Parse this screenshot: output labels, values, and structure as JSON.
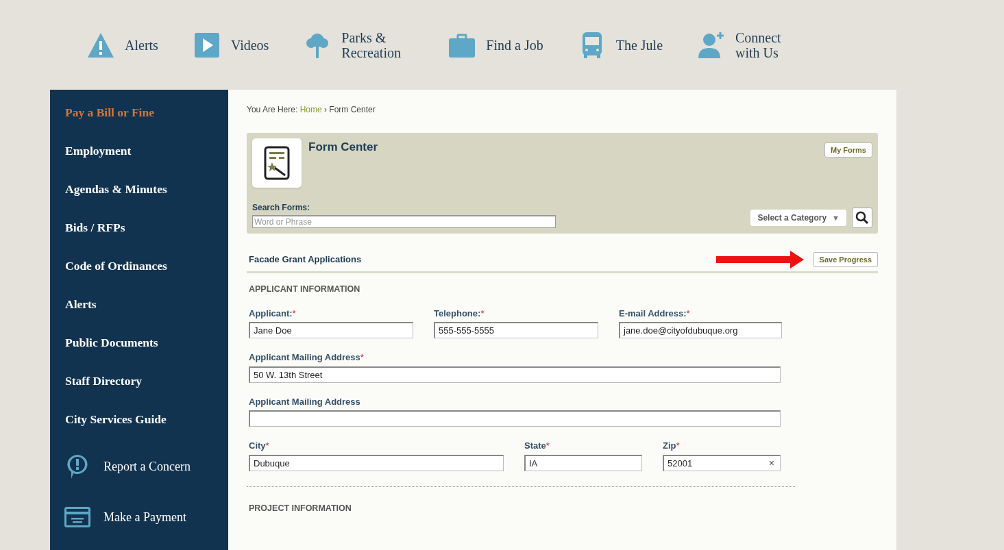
{
  "top_nav": [
    {
      "kind": "alert",
      "label": "Alerts"
    },
    {
      "kind": "video",
      "label": "Videos"
    },
    {
      "kind": "tree",
      "label": "Parks & Recreation"
    },
    {
      "kind": "briefcase",
      "label": "Find a Job"
    },
    {
      "kind": "bus",
      "label": "The Jule"
    },
    {
      "kind": "person",
      "label": "Connect with Us"
    }
  ],
  "sidebar": {
    "items": [
      {
        "label": "Pay a Bill or Fine",
        "selected": true
      },
      {
        "label": "Employment",
        "selected": false
      },
      {
        "label": "Agendas & Minutes",
        "selected": false
      },
      {
        "label": "Bids / RFPs",
        "selected": false
      },
      {
        "label": "Code of Ordinances",
        "selected": false
      },
      {
        "label": "Alerts",
        "selected": false
      },
      {
        "label": "Public Documents",
        "selected": false
      },
      {
        "label": "Staff Directory",
        "selected": false
      },
      {
        "label": "City Services Guide",
        "selected": false
      }
    ],
    "actions": [
      {
        "kind": "concern",
        "label": "Report a Concern"
      },
      {
        "kind": "payment",
        "label": "Make a Payment"
      }
    ]
  },
  "breadcrumb": {
    "prefix": "You Are Here:",
    "links": [
      "Home"
    ],
    "separator": "›",
    "current": "Form Center"
  },
  "form_center": {
    "title": "Form Center",
    "my_forms": "My Forms",
    "search_label": "Search Forms:",
    "search_placeholder": "Word or Phrase",
    "category": "Select a Category",
    "category_caret": "▼"
  },
  "form": {
    "title": "Facade Grant Applications",
    "save": "Save Progress",
    "sections": [
      {
        "heading": "APPLICANT INFORMATION",
        "rows": [
          {
            "kind": "triple",
            "fields": [
              {
                "label": "Applicant:",
                "required": true,
                "value": "Jane Doe"
              },
              {
                "label": "Telephone:",
                "required": true,
                "value": "555-555-5555"
              },
              {
                "label": "E-mail Address:",
                "required": true,
                "value": "jane.doe@cityofdubuque.org"
              }
            ]
          },
          {
            "kind": "single",
            "fields": [
              {
                "label": "Applicant Mailing Address",
                "required": true,
                "value": "50 W. 13th Street"
              }
            ]
          },
          {
            "kind": "single",
            "fields": [
              {
                "label": "Applicant Mailing Address",
                "required": false
              }
            ]
          },
          {
            "kind": "address",
            "fields": [
              {
                "label": "City",
                "required": true,
                "value": "Dubuque"
              },
              {
                "label": "State",
                "required": true,
                "value": "IA"
              },
              {
                "label": "Zip",
                "required": true,
                "value": "52001",
                "clear": "×"
              }
            ]
          }
        ]
      },
      {
        "heading": "PROJECT INFORMATION"
      }
    ],
    "required_mark": "*"
  }
}
